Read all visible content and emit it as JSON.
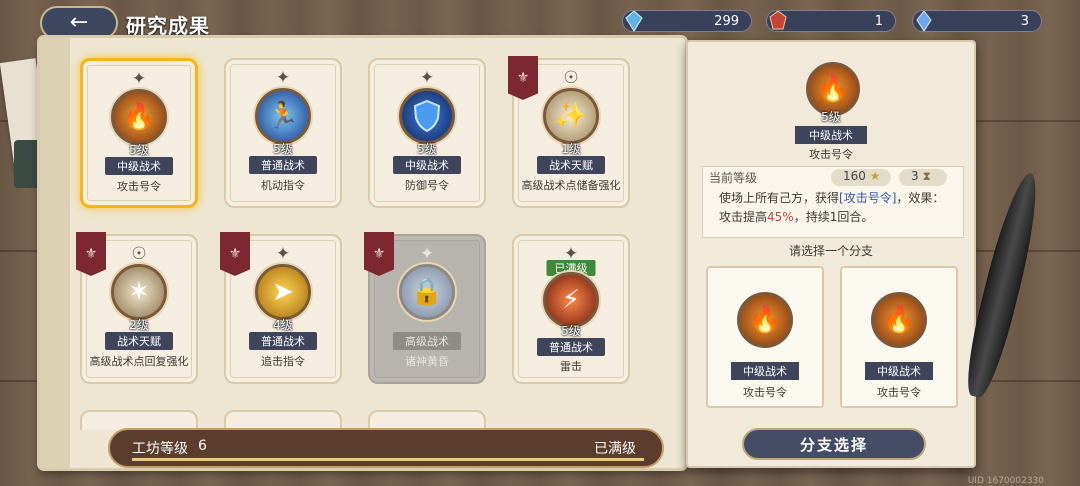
{
  "header": {
    "title": "研究成果",
    "back_icon": "back-arrow-icon"
  },
  "resources": [
    {
      "icon": "blue-crystal-icon",
      "value": "299"
    },
    {
      "icon": "red-gem-icon",
      "value": "1"
    },
    {
      "icon": "blue-gem-icon",
      "value": "3"
    }
  ],
  "cards": [
    {
      "level": "5级",
      "tag": "中级战术",
      "name": "攻击号令",
      "icon": "flame-figure-icon",
      "state": "selected"
    },
    {
      "level": "5级",
      "tag": "普通战术",
      "name": "机动指令",
      "icon": "running-figure-icon",
      "state": "normal"
    },
    {
      "level": "5级",
      "tag": "中级战术",
      "name": "防御号令",
      "icon": "shield-icon",
      "state": "normal"
    },
    {
      "level": "1级",
      "tag": "战术天赋",
      "name": "高级战术点储备强化",
      "icon": "sparkle-icon",
      "state": "normal"
    },
    {
      "level": "2级",
      "tag": "战术天赋",
      "name": "高级战术点回复强化",
      "icon": "compass-icon",
      "state": "normal"
    },
    {
      "level": "4级",
      "tag": "普通战术",
      "name": "追击指令",
      "icon": "arrow-icon",
      "state": "normal"
    },
    {
      "level": "",
      "tag": "高级战术",
      "name": "诸神黄昏",
      "icon": "lock-icon",
      "state": "locked"
    },
    {
      "level": "5级",
      "tag": "普通战术",
      "name": "雷击",
      "icon": "lightning-icon",
      "state": "maxed"
    }
  ],
  "maxed_label": "已满级",
  "workshop": {
    "label": "工坊等级",
    "level": "6",
    "status": "已满级",
    "progress": 1.0
  },
  "panel": {
    "level": "5级",
    "tag": "中级战术",
    "name": "攻击号令",
    "current_level_label": "当前等级",
    "cost_1": "160",
    "cost_2": "3",
    "desc_prefix": "使场上所有己方，获得",
    "desc_skill": "[攻击号令]",
    "desc_middle": "，效果：攻击提高",
    "desc_pct": "45%",
    "desc_suffix": "，持续1回合。",
    "choose_label": "请选择一个分支",
    "branches": [
      {
        "tag": "中级战术",
        "name": "攻击号令"
      },
      {
        "tag": "中级战术",
        "name": "攻击号令"
      }
    ],
    "branch_button": "分支选择"
  },
  "uid": "UID 1670002330",
  "colors": {
    "accent_gold": "#f2b51a",
    "tag_bg": "#3e455b",
    "banner_red": "#7d2730",
    "maxed_green": "#3e8a3a"
  }
}
